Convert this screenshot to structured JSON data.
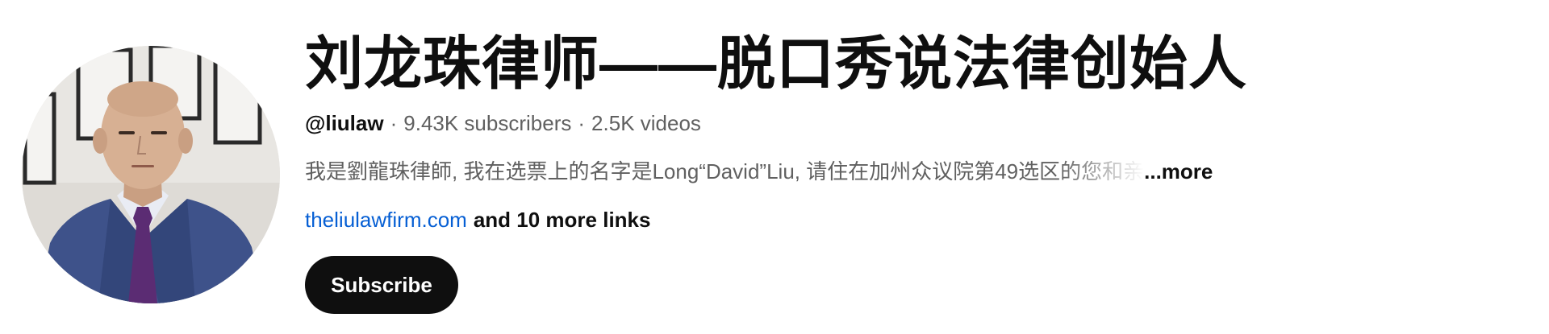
{
  "channel": {
    "name": "刘龙珠律师——脱口秀说法律创始人",
    "handle": "@liulaw",
    "subscribers": "9.43K subscribers",
    "videos": "2.5K videos",
    "separator": "·",
    "description": "我是劉龍珠律師, 我在选票上的名字是Long“David”Liu, 请住在加州众议院第49选区的您和亲",
    "more_label": "...more",
    "link_text": "theliulawfirm.com",
    "more_links_label": "and 10 more links",
    "subscribe_label": "Subscribe"
  },
  "colors": {
    "text_primary": "#0f0f0f",
    "text_secondary": "#606060",
    "link": "#065fd4",
    "button_bg": "#0f0f0f",
    "button_text": "#ffffff"
  },
  "icons": {
    "avatar": "channel-avatar-photo"
  }
}
